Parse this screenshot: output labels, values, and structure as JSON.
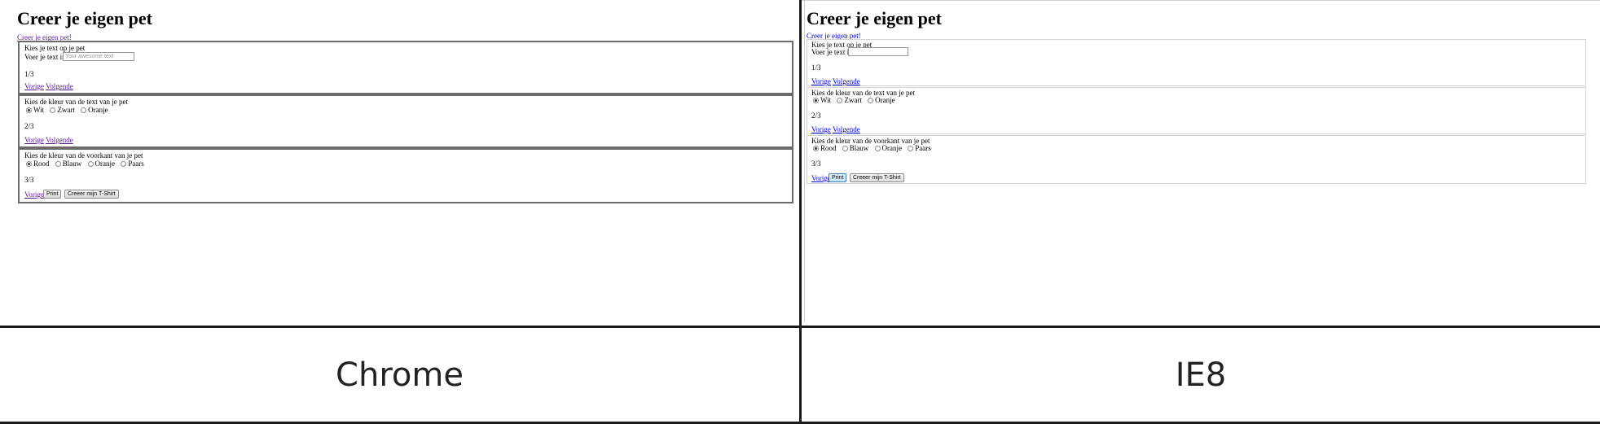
{
  "title": "Creer je eigen pet",
  "top_link": "Creer je eigen pet!",
  "steps": [
    {
      "heading": "Kies je text op je pet",
      "input_label": "Voer je text in",
      "input_placeholder": "Your awesome text",
      "counter": "1/3",
      "links": [
        "Vorige",
        "Volgende"
      ]
    },
    {
      "heading": "Kies de kleur van de text van je pet",
      "options": [
        "Wit",
        "Zwart",
        "Oranje"
      ],
      "selected": "Wit",
      "counter": "2/3",
      "links": [
        "Vorige",
        "Volgende"
      ]
    },
    {
      "heading": "Kies de kleur van de voorkant van je pet",
      "options": [
        "Rood",
        "Blauw",
        "Oranje",
        "Paars"
      ],
      "selected": "Rood",
      "counter": "3/3",
      "link": "Vorige",
      "print_button": "Print",
      "create_button": "Creeer mijn T-Shirt"
    }
  ],
  "captions": {
    "left": "Chrome",
    "right": "IE8"
  },
  "colors": {
    "visited_link": "#551a8b",
    "link": "#0000cc",
    "divider": "#1a1a1a"
  }
}
